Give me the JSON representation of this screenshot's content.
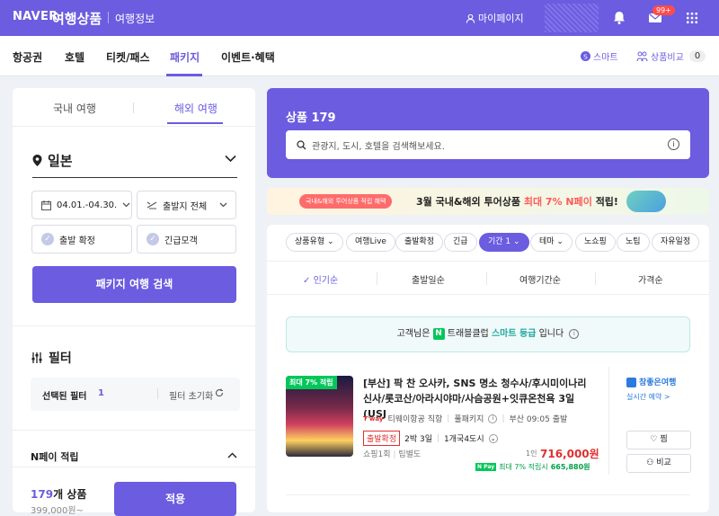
{
  "topbar": {
    "brand": "NAVER",
    "service": "여행상품",
    "section": "여행정보",
    "mypage": "마이페이지",
    "badge": "99+"
  },
  "nav": {
    "items": [
      "항공권",
      "호텔",
      "티켓/패스",
      "패키지",
      "이벤트·혜택"
    ],
    "active": "패키지",
    "smart": "스마트",
    "compare": "상품비교",
    "compare_count": "0"
  },
  "left": {
    "tabs": [
      "국내 여행",
      "해외 여행"
    ],
    "destination": "일본",
    "date": "04.01.-04.30.",
    "departure": "출발지 전체",
    "confirm": "출발 확정",
    "urgent": "긴급모객",
    "search_btn": "패키지 여행 검색",
    "filter_title": "필터",
    "selected_label": "선택된 필터",
    "selected_count": "1",
    "reset": "필터 초기화",
    "npay": "N페이 적립",
    "count_num": "179",
    "count_suffix": "개 상품",
    "count_price": "399,000원~",
    "apply": "적용"
  },
  "hero": {
    "title": "상품 179",
    "placeholder": "관광지, 도시, 호텔을 검색해보세요.",
    "info": "i"
  },
  "banner": {
    "pill": "국내&해외 투어상품 적립 혜택",
    "text_a": "3월 국내&해외 투어상품 ",
    "text_b": "최대 7% N페이",
    "text_c": " 적립!"
  },
  "chips": [
    "상품유형",
    "여행Live",
    "출발확정",
    "긴급",
    "기간 1",
    "테마",
    "노쇼핑",
    "노팁",
    "자유일정"
  ],
  "sorts": [
    "인기순",
    "출발일순",
    "여행기간순",
    "가격순"
  ],
  "member": {
    "pre": "고객님은 ",
    "n": "N",
    "mid": " 트래블클럽 ",
    "grade": "스마트 등급",
    "post": " 입니다"
  },
  "product": {
    "tag": "최대 7% 적립",
    "title": "[부산] 팍 찬 오사카, SNS 명소 청수사/후시미이나리신사/롯코산/아라시야마/사슴공원+잇큐온천욕 3일 (USJ",
    "airline_logo": "T'way",
    "airline": "티웨이항공 직항",
    "type": "풀패키지",
    "depart": "부산 09:05 출발",
    "confirm": "출발확정",
    "duration": "2박 3일",
    "region": "1개국4도시",
    "shopping": "쇼핑1회",
    "tip": "팁별도",
    "per": "1인",
    "price": "716,000원",
    "npay_prefix": "최대 7% 적립시",
    "npay_price": "665,880원",
    "agency": "참좋은여행",
    "reserve": "실시간 예약 >",
    "wish": "찜",
    "compare": "비교"
  },
  "colors": {
    "accent": "#6b5ce0",
    "price": "#e03030",
    "npay": "#03c75a"
  }
}
